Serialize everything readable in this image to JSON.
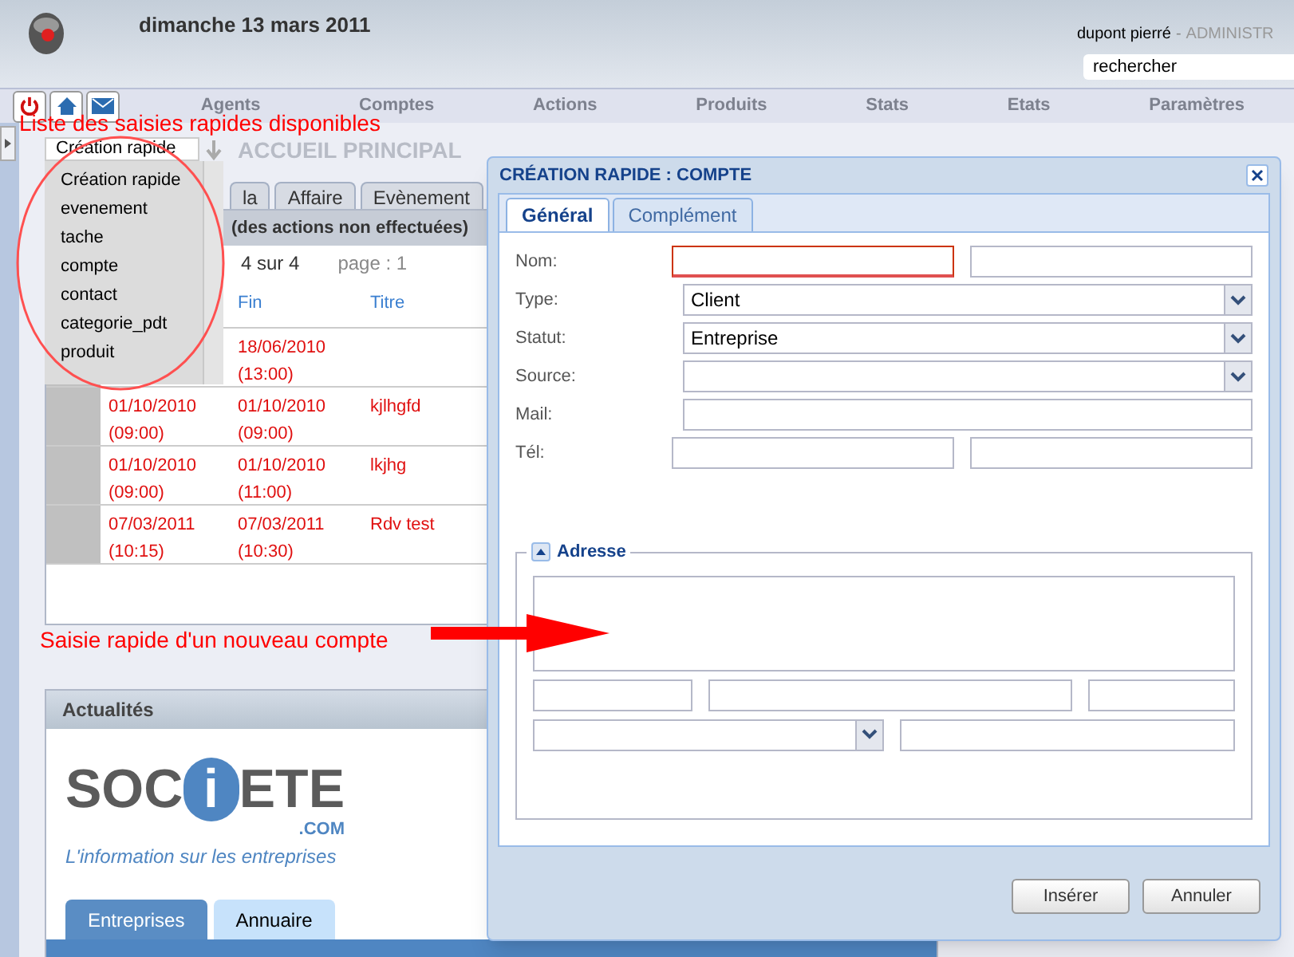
{
  "header": {
    "date": "dimanche 13 mars 2011",
    "user": "dupont pierré",
    "separator": "-",
    "role": "ADMINISTR",
    "search": {
      "value": "rechercher"
    }
  },
  "nav": {
    "items": [
      "Agents",
      "Comptes",
      "Actions",
      "Produits",
      "Stats",
      "Etats",
      "Paramètres"
    ]
  },
  "quick_create": {
    "value": "Création rapide",
    "options": [
      "Création rapide",
      "evenement",
      "tache",
      "compte",
      "contact",
      "categorie_pdt",
      "produit"
    ]
  },
  "home": {
    "title": "ACCUEIL PRINCIPAL",
    "tabs": [
      {
        "label": "la",
        "selected": false
      },
      {
        "label": "Affaire",
        "selected": false
      },
      {
        "label": "Evènement",
        "selected": false
      }
    ],
    "panel_title": "(des actions non effectuées)",
    "pager": "4 sur 4",
    "page": "page : 1",
    "columns": [
      "Fin",
      "Titre"
    ],
    "rows": [
      {
        "end_date": "18/06/2010",
        "end_time": "(13:00)"
      },
      {
        "start_date": "01/10/2010",
        "start_time": "(09:00)",
        "end_date": "01/10/2010",
        "end_time": "(09:00)",
        "title": "kjlhgfd"
      },
      {
        "start_date": "01/10/2010",
        "start_time": "(09:00)",
        "end_date": "01/10/2010",
        "end_time": "(11:00)",
        "title": "lkjhg"
      },
      {
        "start_date": "07/03/2011",
        "start_time": "(10:15)",
        "end_date": "07/03/2011",
        "end_time": "(10:30)",
        "title": "Rdv test"
      }
    ]
  },
  "news": {
    "title": "Actualités",
    "logo": {
      "left": "SOC",
      "mark": "i",
      "right": "ETE",
      "suffix": ".COM"
    },
    "tagline": "L'information sur les entreprises",
    "tabs": [
      {
        "label": "Entreprises",
        "selected": true
      },
      {
        "label": "Annuaire",
        "selected": false
      }
    ]
  },
  "dialog": {
    "title": "CRÉATION RAPIDE : COMPTE",
    "tabs": [
      {
        "label": "Général",
        "selected": true
      },
      {
        "label": "Complément",
        "selected": false
      }
    ],
    "fields": [
      {
        "label": "Nom:",
        "kind": "pair",
        "error": true
      },
      {
        "label": "Type:",
        "kind": "select",
        "value": "Client"
      },
      {
        "label": "Statut:",
        "kind": "select",
        "value": "Entreprise"
      },
      {
        "label": "Source:",
        "kind": "select"
      },
      {
        "label": "Mail:",
        "kind": "text"
      },
      {
        "label": "Tél:",
        "kind": "pair",
        "error": false
      }
    ],
    "address": {
      "legend": "Adresse",
      "expanded": true
    },
    "buttons": [
      "Insérer",
      "Annuler"
    ]
  },
  "annotations": [
    {
      "kind": "circle-note",
      "text": "Liste des saisies rapides disponibles"
    },
    {
      "kind": "arrow-note",
      "text": "Saisie rapide d'un nouveau compte"
    }
  ]
}
